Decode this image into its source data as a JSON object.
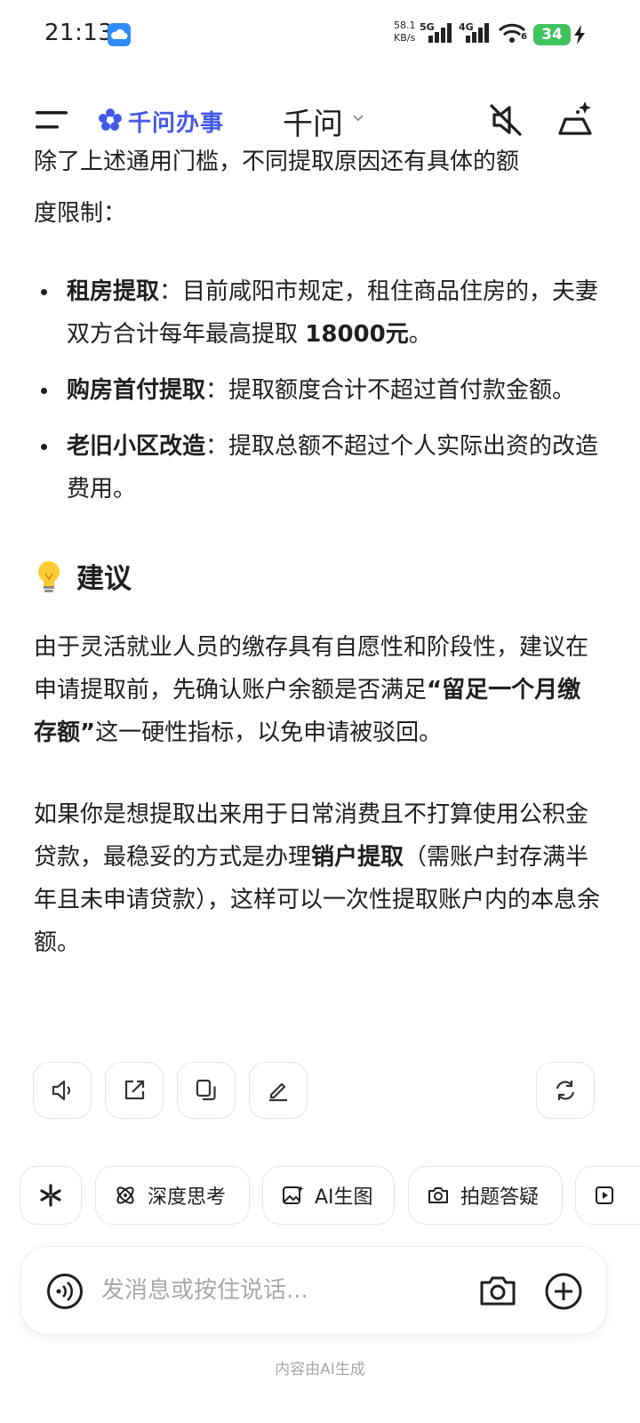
{
  "status_bar": {
    "time": "21:13",
    "net_speed_value": "58.1",
    "net_speed_unit": "KB/s",
    "sig1_label": "5G",
    "sig2_label": "4G",
    "wifi_label": "6",
    "battery": "34"
  },
  "header": {
    "brand": "千问办事",
    "title": "千问",
    "icons": [
      "menu-icon",
      "brand-logo-icon",
      "chevron-down-icon",
      "mute-icon",
      "new-chat-icon"
    ]
  },
  "content": {
    "cut_line": "除了上述通用门槛，不同提取原因还有具体的额",
    "intro_rest": "度限制：",
    "bullets": [
      {
        "bold": "租房提取",
        "text": "：目前咸阳市规定，租住商品住房的，夫妻双方合计每年最高提取 ",
        "bold2": "18000元",
        "tail": "。"
      },
      {
        "bold": "购房首付提取",
        "text": "：提取额度合计不超过首付款金额。",
        "bold2": "",
        "tail": ""
      },
      {
        "bold": "老旧小区改造",
        "text": "：提取总额不超过个人实际出资的改造费用。",
        "bold2": "",
        "tail": ""
      }
    ],
    "section_title": "建议",
    "para1_a": "由于灵活就业人员的缴存具有自愿性和阶段性，建议在申请提取前，先确认账户余额是否满足",
    "para1_bold": "“留足一个月缴存额”",
    "para1_b": "这一硬性指标，以免申请被驳回。",
    "para2_a": "如果你是想提取出来用于日常消费且不打算使用公积金贷款，最稳妥的方式是办理",
    "para2_bold": "销户提取",
    "para2_b": "（需账户封存满半年且未申请贷款），这样可以一次性提取账户内的本息余额。"
  },
  "actions": {
    "icons": [
      "speaker-icon",
      "share-icon",
      "copy-icon",
      "edit-icon",
      "regenerate-icon"
    ]
  },
  "chips": {
    "deep_think": "深度思考",
    "ai_image": "AI生图",
    "photo_qa": "拍题答疑"
  },
  "input": {
    "placeholder": "发消息或按住说话..."
  },
  "footer": {
    "note": "内容由AI生成"
  },
  "colors": {
    "brand": "#4458e8",
    "battery": "#3fc35a",
    "text": "#1f1f1f",
    "muted": "#a7a7a7"
  }
}
